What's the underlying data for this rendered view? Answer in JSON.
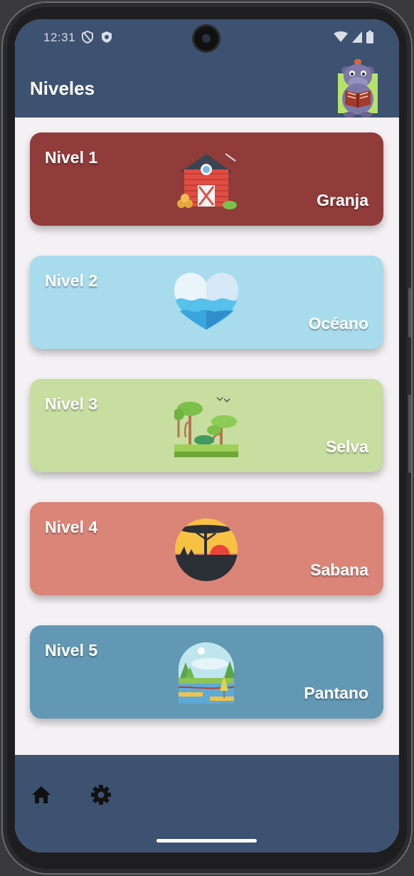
{
  "status_bar": {
    "time": "12:31",
    "icons": [
      "shield-outline-icon",
      "shield-check-icon",
      "wifi-icon",
      "signal-icon",
      "battery-icon"
    ]
  },
  "app_bar": {
    "title": "Niveles",
    "mascot": "hippo-reading-book-icon"
  },
  "levels": [
    {
      "level": "Nivel 1",
      "name": "Granja",
      "color": "#903c3a",
      "icon": "barn-icon"
    },
    {
      "level": "Nivel 2",
      "name": "Océano",
      "color": "#a8dcec",
      "icon": "ocean-heart-icon"
    },
    {
      "level": "Nivel 3",
      "name": "Selva",
      "color": "#c8dda0",
      "icon": "jungle-trees-icon"
    },
    {
      "level": "Nivel 4",
      "name": "Sabana",
      "color": "#da8578",
      "icon": "savanna-sunset-icon"
    },
    {
      "level": "Nivel 5",
      "name": "Pantano",
      "color": "#6398b4",
      "icon": "swamp-landscape-icon"
    }
  ],
  "bottom_nav": {
    "items": [
      "home-icon",
      "settings-gear-icon"
    ]
  },
  "colors": {
    "primary": "#3d5170",
    "background": "#f4f1f4"
  }
}
